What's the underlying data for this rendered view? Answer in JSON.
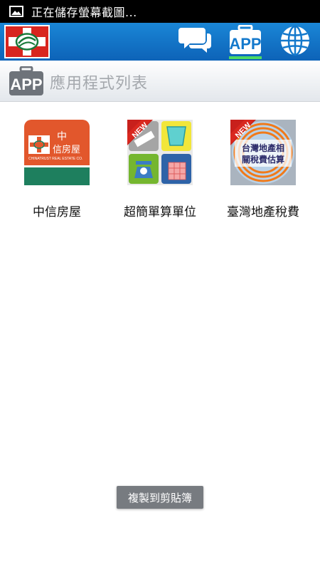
{
  "status_bar": {
    "text": "正在儲存螢幕截圖..."
  },
  "app_bar": {
    "active_tab": "app"
  },
  "section": {
    "title": "應用程式列表"
  },
  "apps": [
    {
      "label": "中信房屋",
      "icon": "chinatrust-realestate-logo",
      "logo_text": "中\n信房屋",
      "logo_small": "CHINATRUST REAL ESTATE CO."
    },
    {
      "label": "超簡單算單位",
      "icon": "unit-converter-icon",
      "badge": "NEW"
    },
    {
      "label": "臺灣地產稅費",
      "icon": "tax-estimator-icon",
      "badge": "NEW",
      "icon_text_1": "台灣地產相",
      "icon_text_2": "關稅費估算"
    }
  ],
  "toast": {
    "text": "複製到剪貼簿"
  },
  "colors": {
    "appbar": "#1479cc",
    "accent": "#4cd964",
    "brand_red": "#d8251f"
  }
}
